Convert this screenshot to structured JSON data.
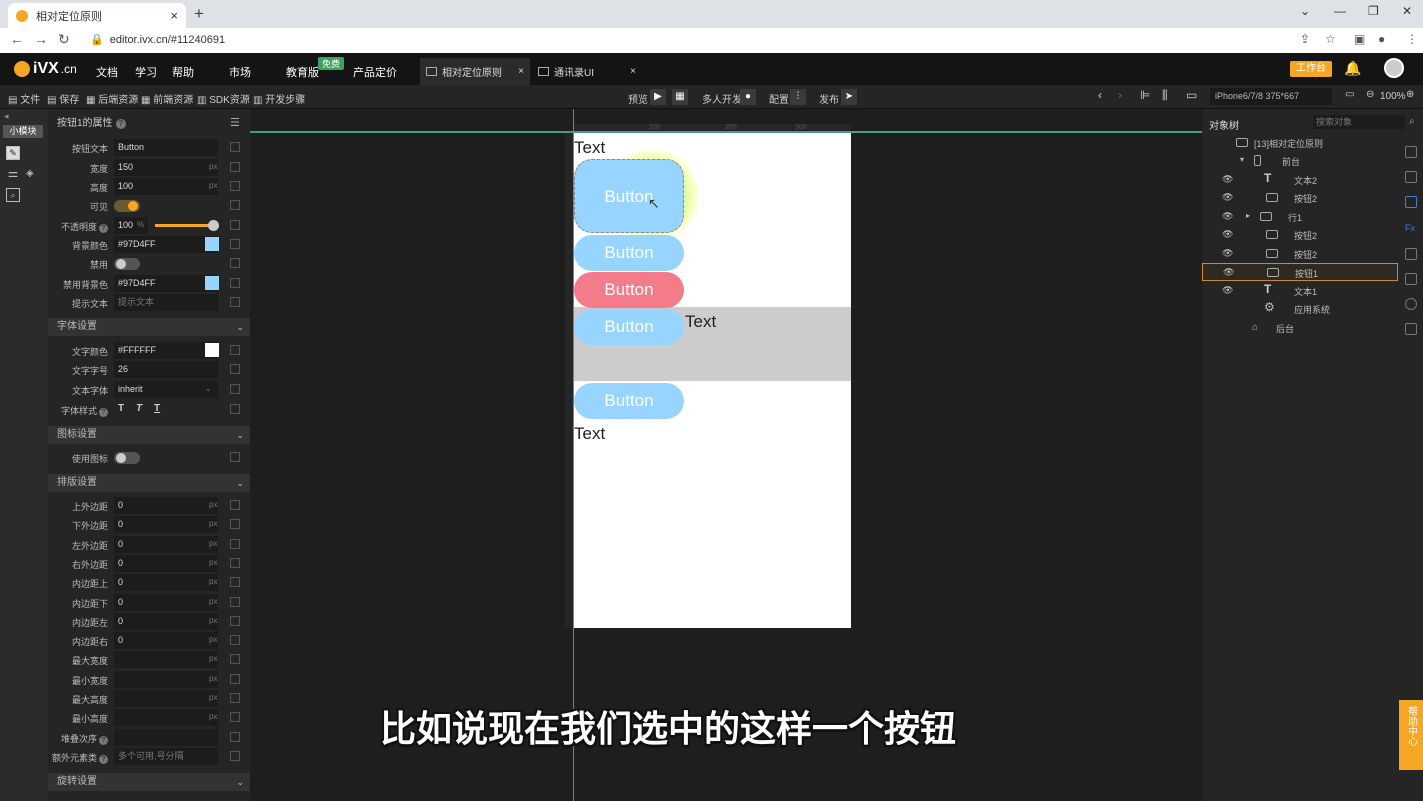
{
  "browser": {
    "tab_title": "相对定位原则",
    "url": "editor.ivx.cn/#11240691"
  },
  "header": {
    "logo": "iVX",
    "logo_domain": ".cn",
    "menu": [
      "文档",
      "学习",
      "帮助",
      "市场",
      "教育版",
      "产品定价"
    ],
    "free_badge": "免费",
    "tabs": [
      {
        "label": "相对定位原则",
        "active": true
      },
      {
        "label": "通讯录UI",
        "active": false
      }
    ],
    "workbench": "工作台"
  },
  "toolbar": {
    "left": [
      "文件",
      "保存",
      "后端资源",
      "前端资源",
      "SDK资源",
      "开发步骤"
    ],
    "preview": "预览",
    "multi": "多人开发",
    "config": "配置",
    "publish": "发布",
    "device": "iPhone6/7/8 375*667",
    "zoom": "100%"
  },
  "rail": {
    "module": "小模块"
  },
  "props": {
    "title": "按钮1的属性",
    "rows": [
      {
        "label": "按钮文本",
        "value": "Button",
        "unit": ""
      },
      {
        "label": "宽度",
        "value": "150",
        "unit": "px"
      },
      {
        "label": "高度",
        "value": "100",
        "unit": "px"
      },
      {
        "label": "可见",
        "toggle": true
      },
      {
        "label": "不透明度",
        "value": "100",
        "unit": "%"
      },
      {
        "label": "背景颜色",
        "value": "#97D4FF",
        "unit": ""
      },
      {
        "label": "禁用",
        "toggle": false
      },
      {
        "label": "禁用背景色",
        "value": "#97D4FF",
        "unit": ""
      },
      {
        "label": "提示文本",
        "value": "提示文本",
        "unit": ""
      }
    ],
    "font_section": "字体设置",
    "font_rows": [
      {
        "label": "文字颜色",
        "value": "#FFFFFF"
      },
      {
        "label": "文字字号",
        "value": "26"
      },
      {
        "label": "文本字体",
        "value": "inherit"
      },
      {
        "label": "字体样式",
        "value": ""
      }
    ],
    "icon_section": "图标设置",
    "icon_row": {
      "label": "使用图标"
    },
    "layout_section": "排版设置",
    "layout_rows": [
      {
        "label": "上外边距",
        "value": "0",
        "unit": "px"
      },
      {
        "label": "下外边距",
        "value": "0",
        "unit": "px"
      },
      {
        "label": "左外边距",
        "value": "0",
        "unit": "px"
      },
      {
        "label": "右外边距",
        "value": "0",
        "unit": "px"
      },
      {
        "label": "内边距上",
        "value": "0",
        "unit": "px"
      },
      {
        "label": "内边距下",
        "value": "0",
        "unit": "px"
      },
      {
        "label": "内边距左",
        "value": "0",
        "unit": "px"
      },
      {
        "label": "内边距右",
        "value": "0",
        "unit": "px"
      },
      {
        "label": "最大宽度",
        "value": "",
        "unit": "px"
      },
      {
        "label": "最小宽度",
        "value": "",
        "unit": "px"
      },
      {
        "label": "最大高度",
        "value": "",
        "unit": "px"
      },
      {
        "label": "最小高度",
        "value": "",
        "unit": "px"
      },
      {
        "label": "堆叠次序",
        "value": "",
        "unit": ""
      },
      {
        "label": "额外元素类",
        "value": "多个可用,号分隔",
        "unit": ""
      }
    ],
    "rotate_section": "旋转设置"
  },
  "canvas": {
    "ruler": [
      "100",
      "200",
      "300"
    ],
    "text1": "Text",
    "buttons": [
      "Button",
      "Button",
      "Button",
      "Button",
      "Button"
    ],
    "text2": "Text",
    "text3": "Text"
  },
  "subtitle": "比如说现在我们选中的这样一个按钮",
  "tree": {
    "title": "对象树",
    "search_placeholder": "搜索对象",
    "nodes": [
      "[13]相对定位原则",
      "前台",
      "文本2",
      "按钮2",
      "行1",
      "按钮2",
      "按钮2",
      "按钮1",
      "文本1",
      "应用系统",
      "后台"
    ]
  },
  "help": "帮助中心",
  "colors": {
    "accent": "#f5a623",
    "button_blue": "#97D4FF",
    "button_red": "#F47B8A"
  }
}
